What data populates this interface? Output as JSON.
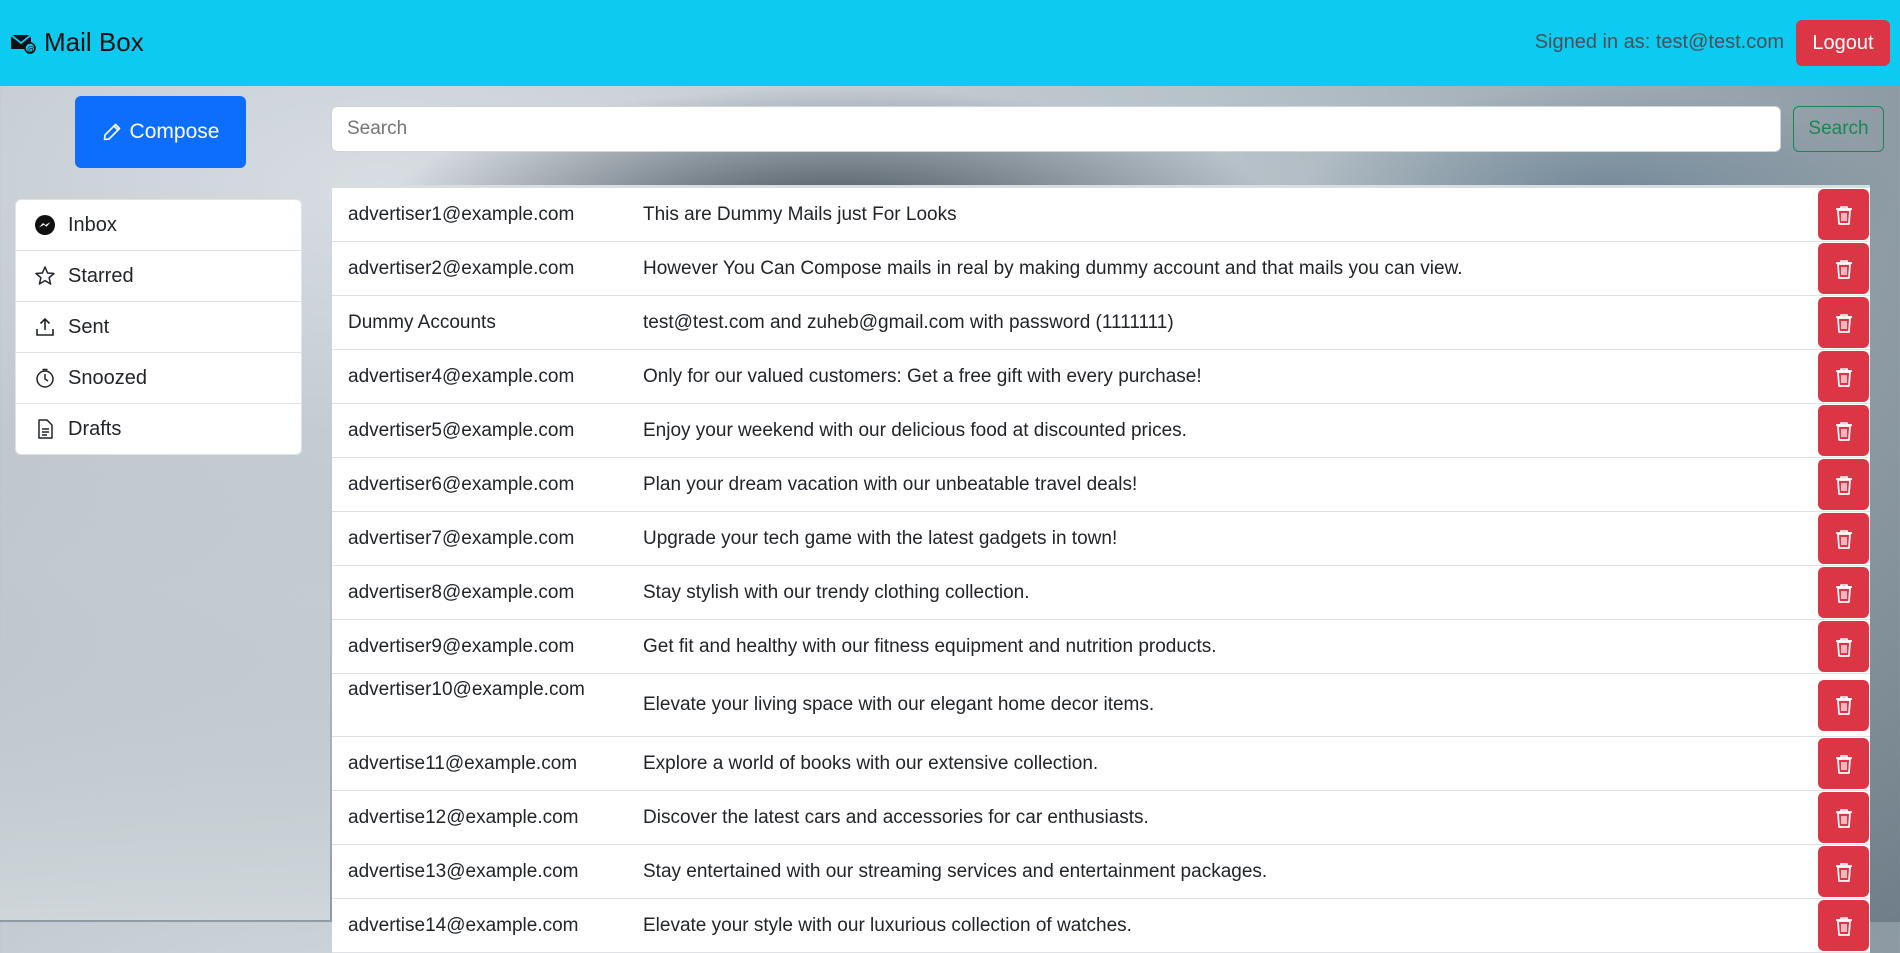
{
  "header": {
    "brand": "Mail Box",
    "signed_in": "Signed in as: test@test.com",
    "logout_label": "Logout"
  },
  "sidebar": {
    "compose_label": "Compose",
    "items": [
      {
        "label": "Inbox",
        "icon": "messenger-icon"
      },
      {
        "label": "Starred",
        "icon": "star-icon"
      },
      {
        "label": "Sent",
        "icon": "upload-icon"
      },
      {
        "label": "Snoozed",
        "icon": "clock-icon"
      },
      {
        "label": "Drafts",
        "icon": "document-icon"
      }
    ]
  },
  "search": {
    "placeholder": "Search",
    "button_label": "Search"
  },
  "mails": [
    {
      "sender": "advertiser1@example.com",
      "subject": "This are Dummy Mails just For Looks"
    },
    {
      "sender": "advertiser2@example.com",
      "subject": "However You Can Compose mails in real by making dummy account and that mails you can view."
    },
    {
      "sender": "Dummy Accounts",
      "subject": "test@test.com and zuheb@gmail.com with password (1111111)"
    },
    {
      "sender": "advertiser4@example.com",
      "subject": "Only for our valued customers: Get a free gift with every purchase!"
    },
    {
      "sender": "advertiser5@example.com",
      "subject": "Enjoy your weekend with our delicious food at discounted prices."
    },
    {
      "sender": "advertiser6@example.com",
      "subject": "Plan your dream vacation with our unbeatable travel deals!"
    },
    {
      "sender": "advertiser7@example.com",
      "subject": "Upgrade your tech game with the latest gadgets in town!"
    },
    {
      "sender": "advertiser8@example.com",
      "subject": "Stay stylish with our trendy clothing collection."
    },
    {
      "sender": "advertiser9@example.com",
      "subject": "Get fit and healthy with our fitness equipment and nutrition products."
    },
    {
      "sender": "advertiser10@example.com",
      "subject": "Elevate your living space with our elegant home decor items."
    },
    {
      "sender": "advertise11@example.com",
      "subject": "Explore a world of books with our extensive collection."
    },
    {
      "sender": "advertise12@example.com",
      "subject": "Discover the latest cars and accessories for car enthusiasts."
    },
    {
      "sender": "advertise13@example.com",
      "subject": "Stay entertained with our streaming services and entertainment packages."
    },
    {
      "sender": "advertise14@example.com",
      "subject": "Elevate your style with our luxurious collection of watches."
    }
  ],
  "colors": {
    "navbar": "#0dcaf0",
    "danger": "#dc3545",
    "primary": "#0d6efd",
    "success": "#198754"
  }
}
